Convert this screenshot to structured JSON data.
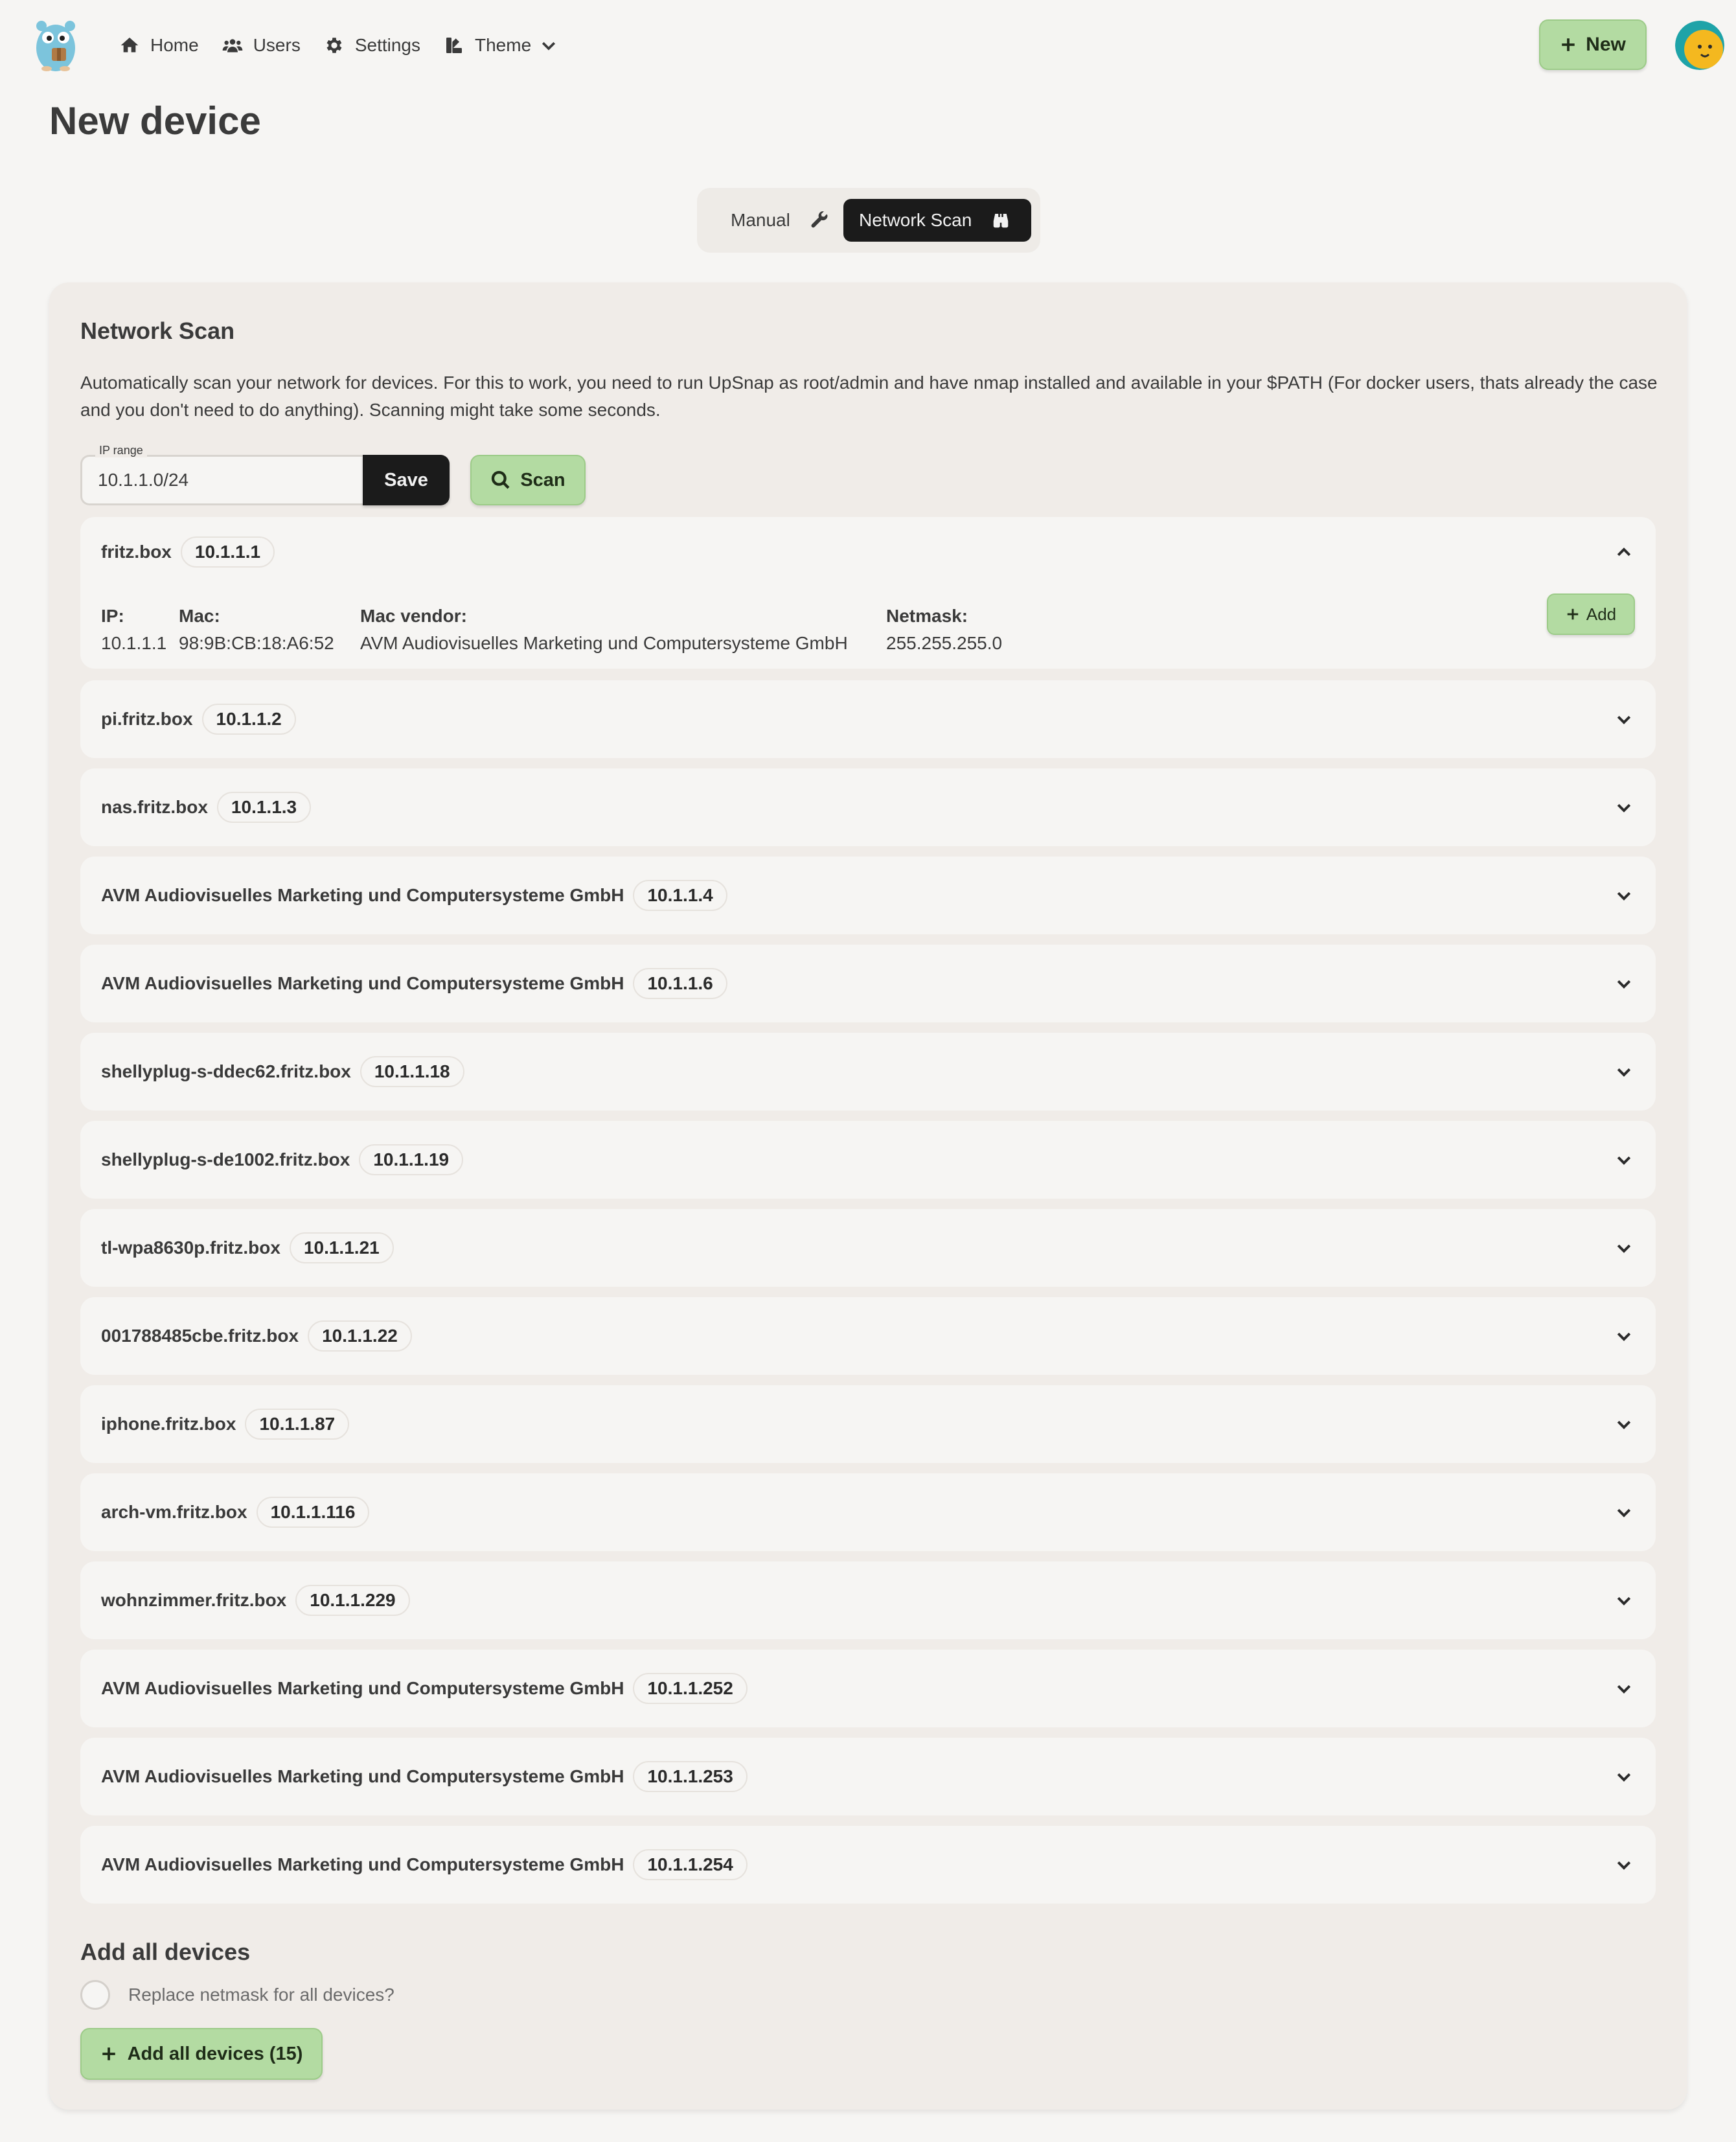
{
  "nav": {
    "home": "Home",
    "users": "Users",
    "settings": "Settings",
    "theme": "Theme",
    "new_button": "New"
  },
  "page": {
    "title": "New device"
  },
  "tabs": {
    "manual": "Manual",
    "network_scan": "Network Scan",
    "active": "Network Scan"
  },
  "scan": {
    "title": "Network Scan",
    "description": "Automatically scan your network for devices. For this to work, you need to run UpSnap as root/admin and have nmap installed and available in your $PATH (For docker users, thats already the case and you don't need to do anything). Scanning might take some seconds.",
    "ip_range_label": "IP range",
    "ip_range_value": "10.1.1.0/24",
    "save_label": "Save",
    "scan_label": "Scan"
  },
  "expanded_device": {
    "ip_label": "IP:",
    "ip": "10.1.1.1",
    "mac_label": "Mac:",
    "mac": "98:9B:CB:18:A6:52",
    "vendor_label": "Mac vendor:",
    "vendor": "AVM Audiovisuelles Marketing und Computersysteme GmbH",
    "netmask_label": "Netmask:",
    "netmask": "255.255.255.0",
    "add_label": "Add"
  },
  "devices": [
    {
      "name": "fritz.box",
      "ip": "10.1.1.1"
    },
    {
      "name": "pi.fritz.box",
      "ip": "10.1.1.2"
    },
    {
      "name": "nas.fritz.box",
      "ip": "10.1.1.3"
    },
    {
      "name": "AVM Audiovisuelles Marketing und Computersysteme GmbH",
      "ip": "10.1.1.4"
    },
    {
      "name": "AVM Audiovisuelles Marketing und Computersysteme GmbH",
      "ip": "10.1.1.6"
    },
    {
      "name": "shellyplug-s-ddec62.fritz.box",
      "ip": "10.1.1.18"
    },
    {
      "name": "shellyplug-s-de1002.fritz.box",
      "ip": "10.1.1.19"
    },
    {
      "name": "tl-wpa8630p.fritz.box",
      "ip": "10.1.1.21"
    },
    {
      "name": "001788485cbe.fritz.box",
      "ip": "10.1.1.22"
    },
    {
      "name": "iphone.fritz.box",
      "ip": "10.1.1.87"
    },
    {
      "name": "arch-vm.fritz.box",
      "ip": "10.1.1.116"
    },
    {
      "name": "wohnzimmer.fritz.box",
      "ip": "10.1.1.229"
    },
    {
      "name": "AVM Audiovisuelles Marketing und Computersysteme GmbH",
      "ip": "10.1.1.252"
    },
    {
      "name": "AVM Audiovisuelles Marketing und Computersysteme GmbH",
      "ip": "10.1.1.253"
    },
    {
      "name": "AVM Audiovisuelles Marketing und Computersysteme GmbH",
      "ip": "10.1.1.254"
    }
  ],
  "add_all": {
    "title": "Add all devices",
    "replace_netmask": "Replace netmask for all devices?",
    "button": "Add all devices (15)"
  },
  "colors": {
    "background": "#f6f5f3",
    "card": "#f0ece8",
    "accent_green": "#b3dba2",
    "dark": "#1b1b1b"
  }
}
